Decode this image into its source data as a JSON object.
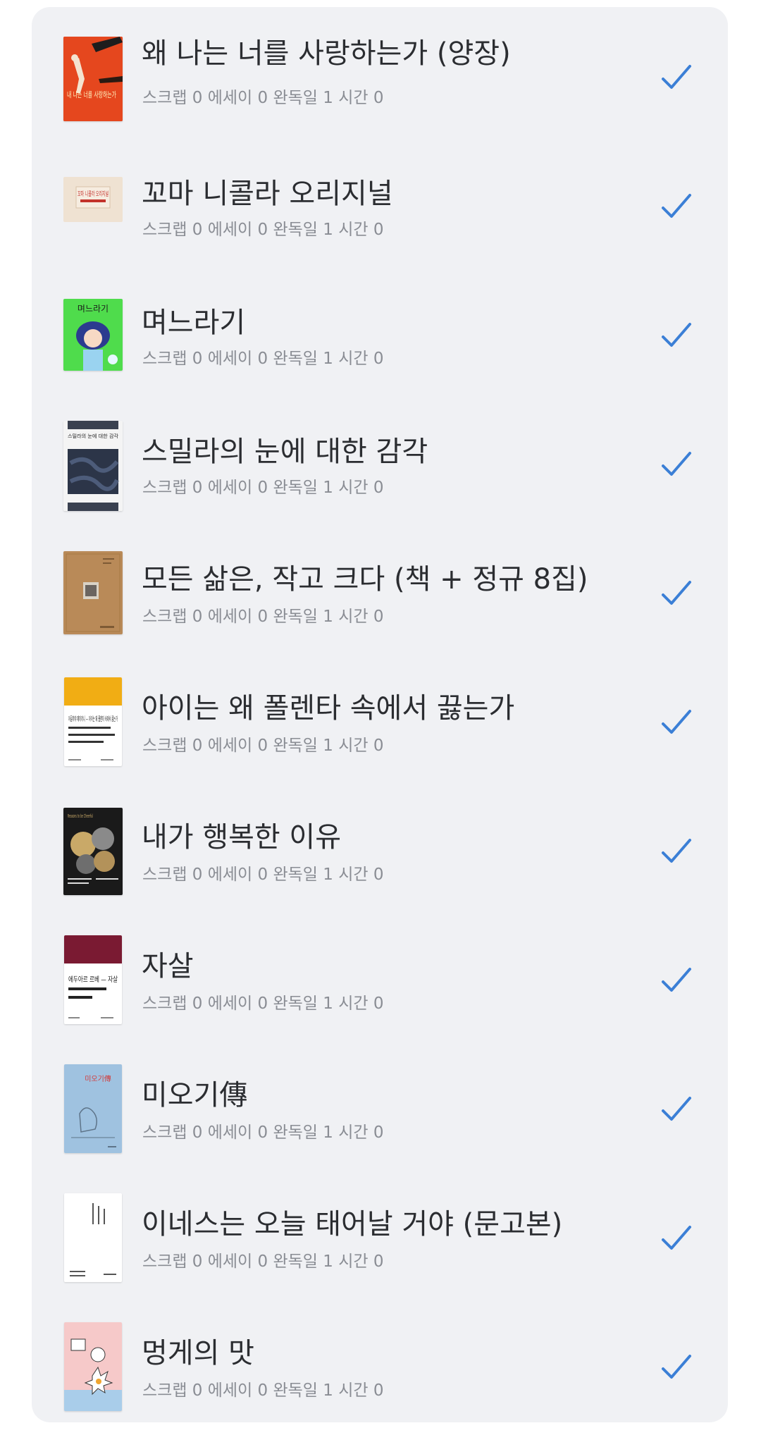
{
  "accent": "#3b7fd6",
  "books": [
    {
      "title": "왜 나는 너를 사랑하는가 (양장)",
      "meta": "스크랩 0 에세이 0 완독일 1 시간 0",
      "cover_icon": "book-cover-red-illustration"
    },
    {
      "title": "꼬마 니콜라 오리지널",
      "meta": "스크랩 0 에세이 0 완독일 1 시간 0",
      "cover_icon": "book-cover-beige-box"
    },
    {
      "title": "며느라기",
      "meta": "스크랩 0 에세이 0 완독일 1 시간 0",
      "cover_icon": "book-cover-green-girl"
    },
    {
      "title": "스밀라의 눈에 대한 감각",
      "meta": "스크랩 0 에세이 0 완독일 1 시간 0",
      "cover_icon": "book-cover-dark-photo"
    },
    {
      "title": "모든 삶은, 작고 크다 (책 + 정규 8집)",
      "meta": "스크랩 0 에세이 0 완독일 1 시간 0",
      "cover_icon": "book-cover-brown-kraft"
    },
    {
      "title": "아이는 왜 폴렌타 속에서 끓는가",
      "meta": "스크랩 0 에세이 0 완독일 1 시간 0",
      "cover_icon": "book-cover-yellow-white"
    },
    {
      "title": "내가 행복한 이유",
      "meta": "스크랩 0 에세이 0 완독일 1 시간 0",
      "cover_icon": "book-cover-black-pattern"
    },
    {
      "title": "자살",
      "meta": "스크랩 0 에세이 0 완독일 1 시간 0",
      "cover_icon": "book-cover-maroon-white"
    },
    {
      "title": "미오기傳",
      "meta": "스크랩 0 에세이 0 완독일 1 시간 0",
      "cover_icon": "book-cover-light-blue"
    },
    {
      "title": "이네스는 오늘 태어날 거야 (문고본)",
      "meta": "스크랩 0 에세이 0 완독일 1 시간 0",
      "cover_icon": "book-cover-white-minimal"
    },
    {
      "title": "멍게의 맛",
      "meta": "스크랩 0 에세이 0 완독일 1 시간 0",
      "cover_icon": "book-cover-pink-shapes"
    }
  ],
  "cover_texts": {
    "cover1_text": "내 나는 너를 사랑하는가",
    "cover2_text": "꼬마 니콜라 오리지널",
    "cover3_text": "며느라기",
    "cover4_text": "스밀라의 눈에 대한 감각",
    "cover6_text": "아글라야 페터라니 — 아이는 왜 폴렌타 속에서 끓는가",
    "cover7_text": "Reasons to be Cheerful",
    "cover8_text": "에두아르 르베 — 자살",
    "cover9_text": "미오기傳"
  }
}
